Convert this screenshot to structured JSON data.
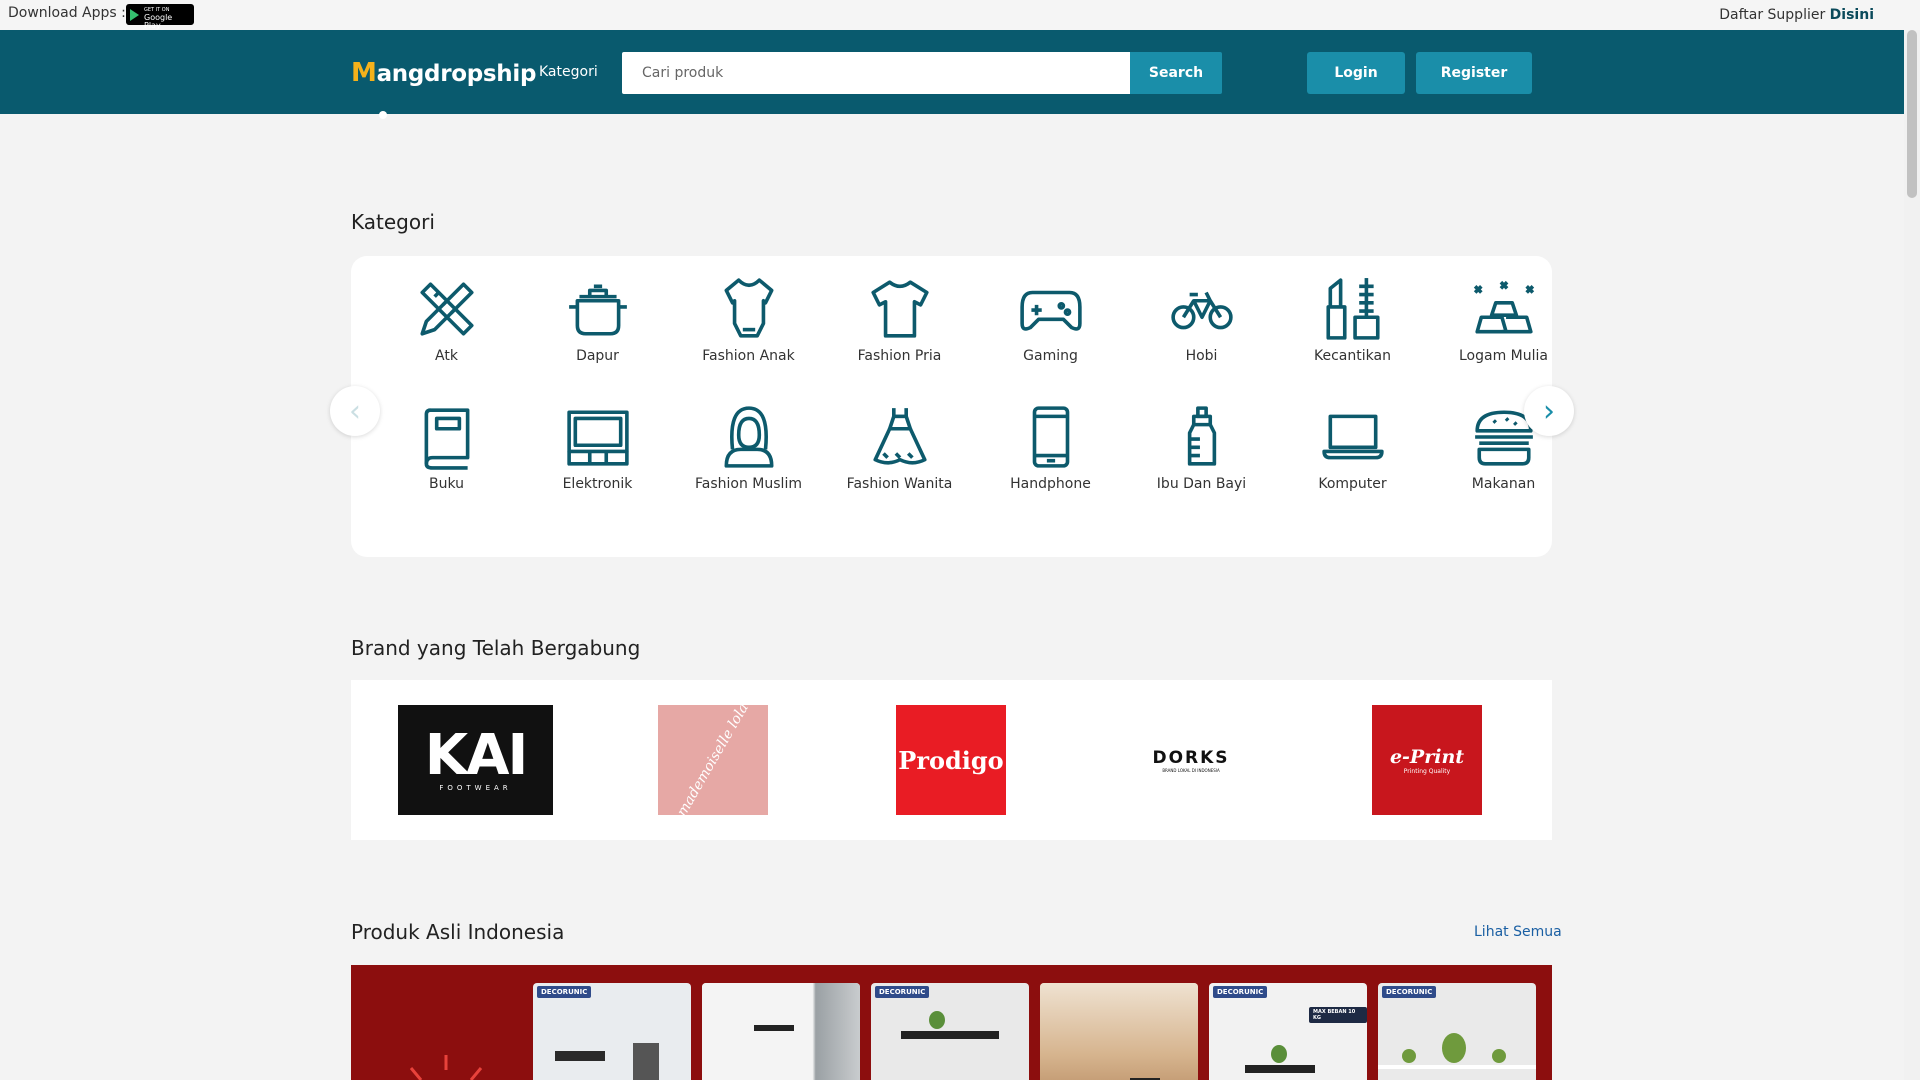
{
  "topbar": {
    "download_label": "Download Apps :",
    "gplay_small": "GET IT ON",
    "gplay_big": "Google Play",
    "supplier_text": "Daftar Supplier",
    "supplier_link": "Disini"
  },
  "header": {
    "logo_text": "angdropship",
    "logo_letter": "M",
    "nav_kategori": "Kategori",
    "search_placeholder": "Cari produk",
    "search_button": "Search",
    "login_button": "Login",
    "register_button": "Register"
  },
  "kategori": {
    "title": "Kategori",
    "items": [
      {
        "label": "Atk",
        "icon": "ruler-pencil-icon"
      },
      {
        "label": "Dapur",
        "icon": "cooking-pot-icon"
      },
      {
        "label": "Fashion Anak",
        "icon": "baby-onesie-icon"
      },
      {
        "label": "Fashion Pria",
        "icon": "tshirt-icon"
      },
      {
        "label": "Gaming",
        "icon": "gamepad-icon"
      },
      {
        "label": "Hobi",
        "icon": "bicycle-icon"
      },
      {
        "label": "Kecantikan",
        "icon": "lipstick-icon"
      },
      {
        "label": "Logam Mulia",
        "icon": "gold-bars-icon"
      },
      {
        "label": "Buku",
        "icon": "book-icon"
      },
      {
        "label": "Elektronik",
        "icon": "tv-icon"
      },
      {
        "label": "Fashion Muslim",
        "icon": "hijab-icon"
      },
      {
        "label": "Fashion Wanita",
        "icon": "dress-icon"
      },
      {
        "label": "Handphone",
        "icon": "smartphone-icon"
      },
      {
        "label": "Ibu Dan Bayi",
        "icon": "baby-bottle-icon"
      },
      {
        "label": "Komputer",
        "icon": "laptop-icon"
      },
      {
        "label": "Makanan",
        "icon": "burger-icon"
      }
    ]
  },
  "brands": {
    "title": "Brand yang Telah Bergabung",
    "items": [
      {
        "name": "KAI",
        "sub": "FOOTWEAR"
      },
      {
        "name": "mademoiselle lola"
      },
      {
        "name": "Prodigo"
      },
      {
        "name": "DORKS",
        "sub": "BRAND LOKAL DI INDONESIA"
      },
      {
        "name": "e-Print",
        "sub": "Printing Quality"
      }
    ]
  },
  "produk": {
    "title": "Produk Asli Indonesia",
    "see_all": "Lihat Semua",
    "card_tag": "DECORUNIC",
    "max_beban": "MAX BEBAN 10 KG"
  },
  "colors": {
    "header_bg": "#095a6e",
    "button_bg": "#1a8ea9",
    "icon_color": "#0d5a6c",
    "promo_bg": "#8c0e0e"
  }
}
